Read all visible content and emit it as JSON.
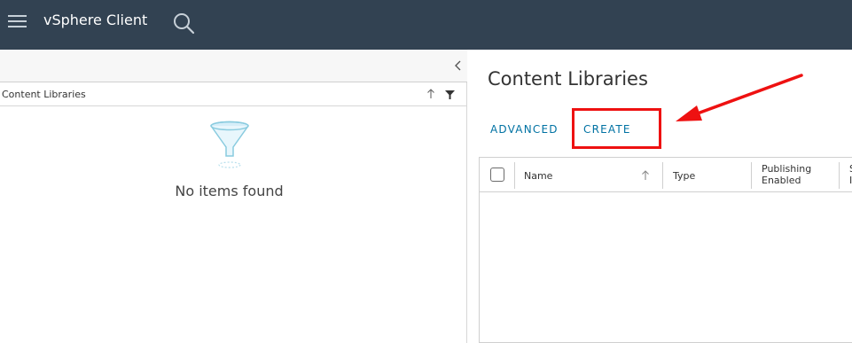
{
  "header": {
    "app_title": "vSphere Client",
    "menu_icon": "hamburger-menu-icon",
    "search_icon": "search-icon",
    "background": "#324252"
  },
  "left_panel": {
    "collapse_icon": "chevron-left-icon",
    "tree_title": "Content Libraries",
    "sort_icon": "sort-arrow-up-icon",
    "filter_icon": "filter-icon",
    "empty_icon": "empty-funnel-icon",
    "empty_text": "No items found"
  },
  "right_panel": {
    "page_title": "Content Libraries",
    "actions": {
      "advanced_label": "ADVANCED",
      "create_label": "CREATE"
    },
    "link_color": "#0072a3",
    "annotation_color": "#ee1111",
    "grid": {
      "columns": [
        "Name",
        "Type",
        "Publishing Enabled"
      ],
      "columns_two_line": {
        "publishing_line1": "Publishing",
        "publishing_line2": "Enabled"
      },
      "truncated_col_line1": "S",
      "truncated_col_line2": "I",
      "rows": []
    }
  }
}
